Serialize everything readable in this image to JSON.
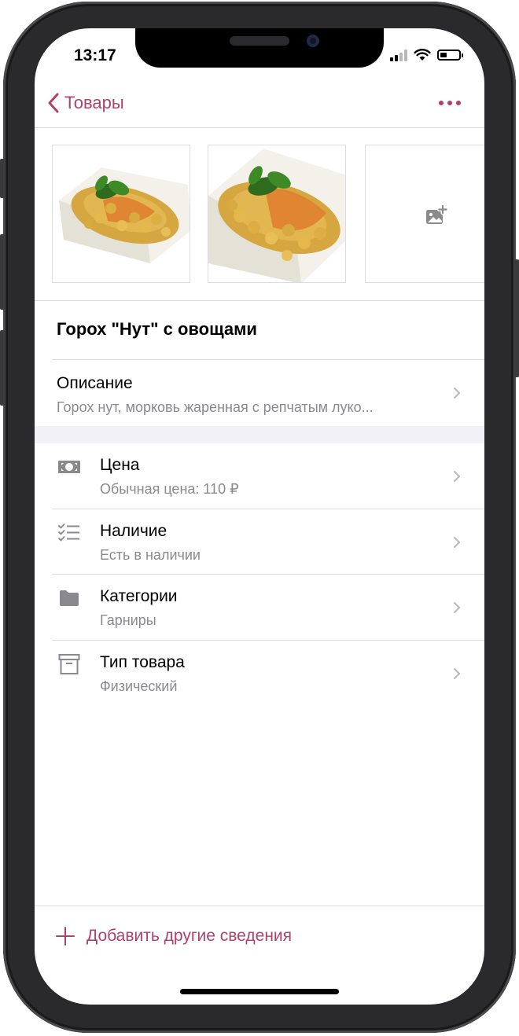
{
  "status_bar": {
    "time": "13:17"
  },
  "nav": {
    "back_label": "Товары"
  },
  "product": {
    "name": "Горох \"Нут\" с овощами"
  },
  "description": {
    "title": "Описание",
    "text": "Горох нут, морковь жаренная с репчатым луко..."
  },
  "rows": [
    {
      "title": "Цена",
      "subtitle": "Обычная цена: 110 ₽",
      "icon": "banknote-icon"
    },
    {
      "title": "Наличие",
      "subtitle": "Есть в наличии",
      "icon": "checklist-icon"
    },
    {
      "title": "Категории",
      "subtitle": "Гарниры",
      "icon": "folder-icon"
    },
    {
      "title": "Тип товара",
      "subtitle": "Физический",
      "icon": "archive-box-icon"
    }
  ],
  "footer": {
    "add_label": "Добавить другие сведения"
  },
  "colors": {
    "accent": "#b0406c",
    "secondary_text": "#8a8a8e",
    "icon_gray": "#8a8a8e",
    "separator": "#dcdcdf",
    "group_background": "#f2f2f6"
  }
}
